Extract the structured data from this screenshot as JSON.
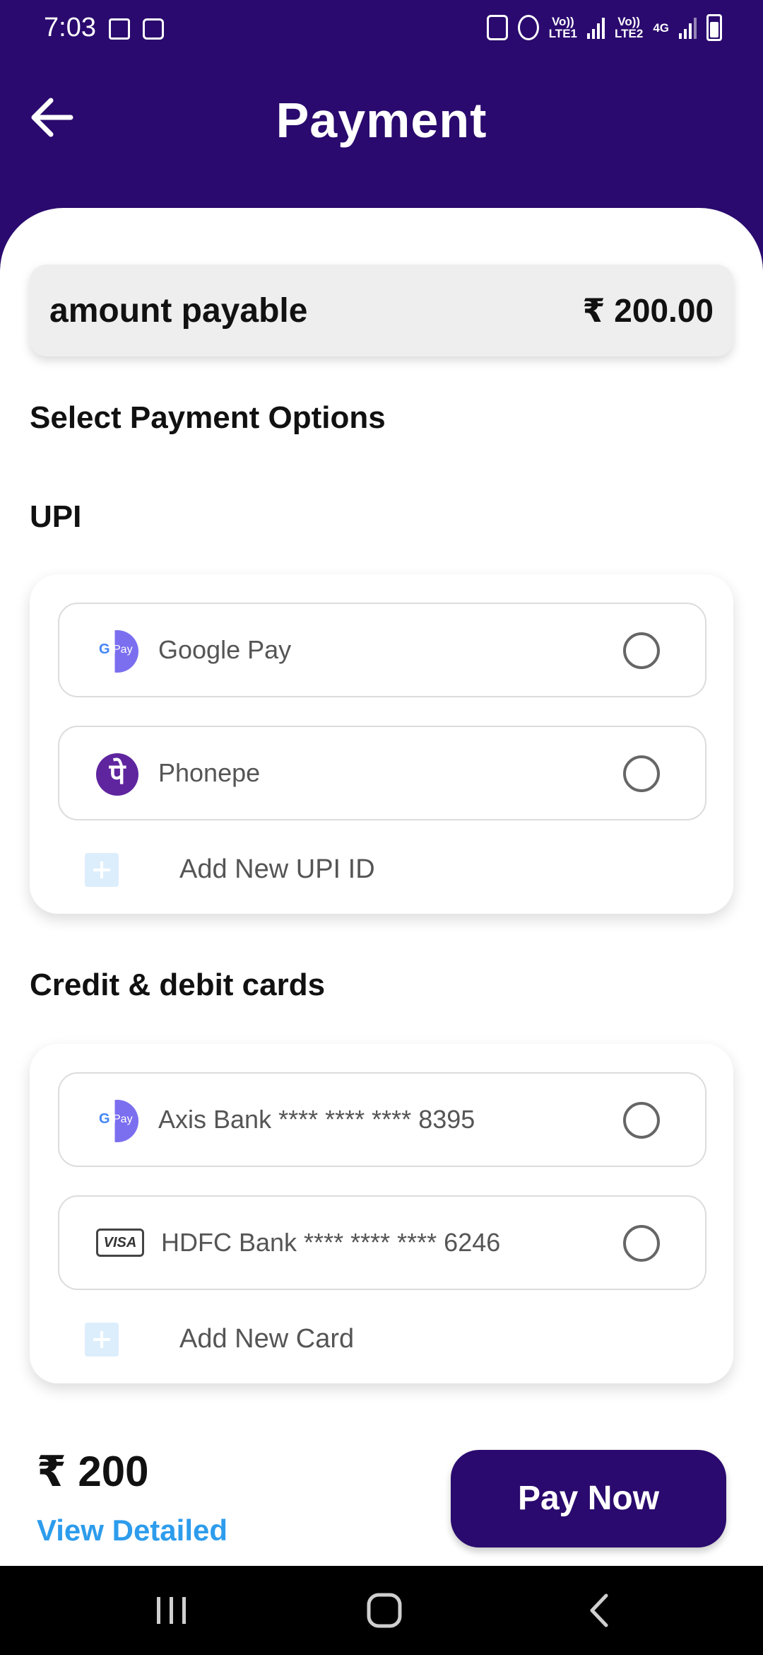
{
  "status_bar": {
    "time": "7:03",
    "lte1": "Vo))\nLTE1",
    "lte2": "Vo))\nLTE2",
    "network": "4G"
  },
  "header": {
    "title": "Payment",
    "back_icon": "arrow-left-icon"
  },
  "amount": {
    "label": "amount payable",
    "value": "₹ 200.00"
  },
  "sections": {
    "select_title": "Select Payment Options",
    "upi_title": "UPI",
    "cards_title": "Credit & debit cards"
  },
  "upi": {
    "options": [
      {
        "label": "Google Pay",
        "icon": "google-pay-icon",
        "selected": false
      },
      {
        "label": "Phonepe",
        "icon": "phonepe-icon",
        "selected": false
      }
    ],
    "add_label": "Add New UPI ID"
  },
  "cards": {
    "options": [
      {
        "label": "Axis Bank **** **** **** 8395",
        "icon": "google-pay-icon",
        "selected": false
      },
      {
        "label": "HDFC Bank **** **** **** 6246",
        "icon": "visa-icon",
        "selected": false
      }
    ],
    "add_label": "Add New Card"
  },
  "footer": {
    "total": "₹ 200",
    "view_detailed": "View Detailed",
    "pay_button": "Pay Now"
  },
  "icons": {
    "gpay_g": "G",
    "gpay_pay": "Pay",
    "phonepe_glyph": "पे",
    "visa_text": "VISA"
  },
  "colors": {
    "primary": "#2a0a6e",
    "link": "#2d9cec",
    "phonepe": "#5f259f"
  }
}
